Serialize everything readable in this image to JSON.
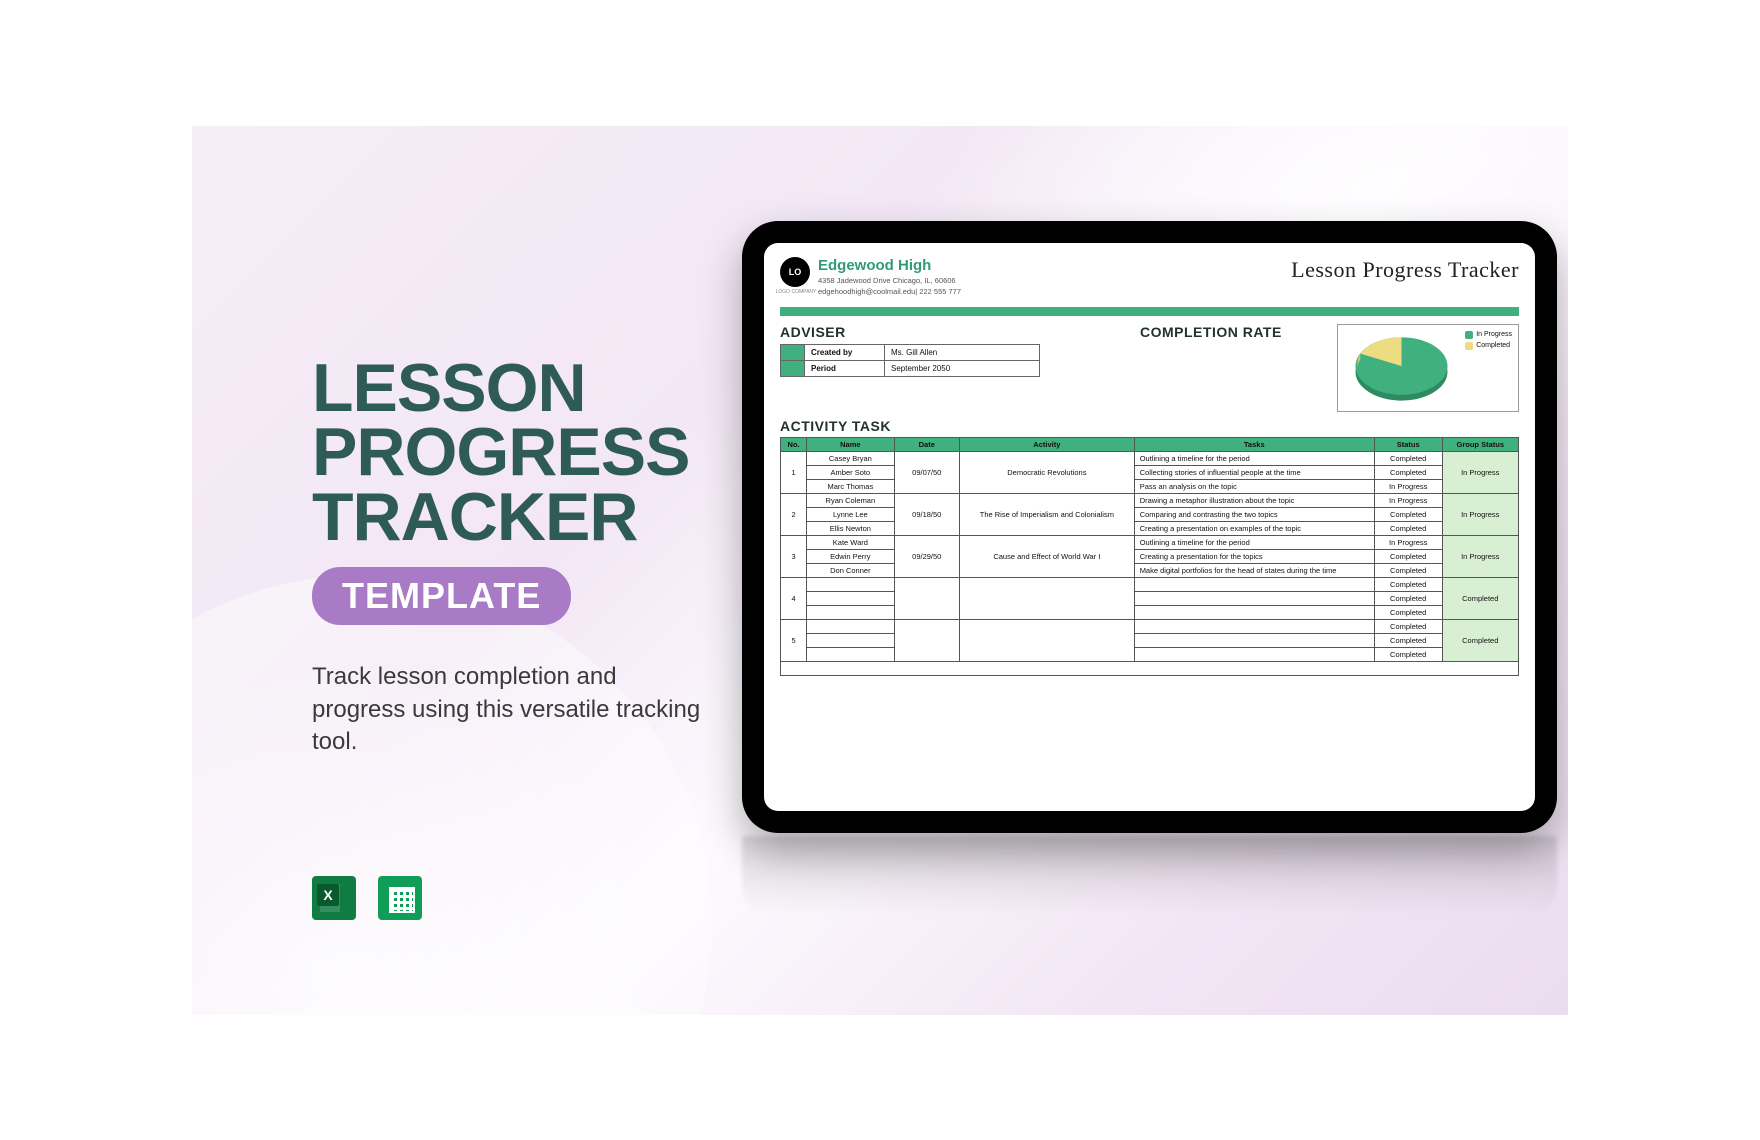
{
  "promo": {
    "title_l1": "LESSON",
    "title_l2": "PROGRESS",
    "title_l3": "TRACKER",
    "badge": "TEMPLATE",
    "desc": "Track lesson completion and progress using this versatile tracking tool."
  },
  "tracker": {
    "logo_text": "LO GO",
    "school": "Edgewood High",
    "address": "4358 Jadewood Drive Chicago, IL, 60606",
    "contact": "edgehoodhigh@coolmail.edu| 222 555 777",
    "page_title": "Lesson Progress Tracker",
    "adviser_h": "ADVISER",
    "adviser": {
      "created_by_label": "Created by",
      "created_by": "Ms. Gill Allen",
      "period_label": "Period",
      "period": "September 2050"
    },
    "completion_h": "COMPLETION RATE",
    "legend": {
      "inprog": "In Progress",
      "completed": "Completed"
    },
    "activity_h": "ACTIVITY TASK",
    "headers": {
      "no": "No.",
      "name": "Name",
      "date": "Date",
      "activity": "Activity",
      "tasks": "Tasks",
      "status": "Status",
      "group": "Group Status"
    },
    "rows": [
      {
        "no": "1",
        "names": [
          "Casey Bryan",
          "Amber Soto",
          "Marc Thomas"
        ],
        "date": "09/07/50",
        "activity": "Democratic Revolutions",
        "tasks": [
          "Outlining a timeline for the period",
          "Collecting stories of influential people at the time",
          "Pass an analysis on the topic"
        ],
        "statuses": [
          "Completed",
          "Completed",
          "In Progress"
        ],
        "group": "In Progress"
      },
      {
        "no": "2",
        "names": [
          "Ryan Coleman",
          "Lynne Lee",
          "Ellis Newton"
        ],
        "date": "09/18/50",
        "activity": "The Rise of Imperialism and Colonialism",
        "tasks": [
          "Drawing a metaphor illustration about the topic",
          "Comparing and contrasting the two topics",
          "Creating a presentation on examples of the topic"
        ],
        "statuses": [
          "In Progress",
          "Completed",
          "Completed"
        ],
        "group": "In Progress"
      },
      {
        "no": "3",
        "names": [
          "Kate Ward",
          "Edwin Perry",
          "Don Conner"
        ],
        "date": "09/29/50",
        "activity": "Cause and Effect of World War I",
        "tasks": [
          "Outlining a timeline for the period",
          "Creating a presentation for the topics",
          "Make digital portfolios for the head of states during the time"
        ],
        "statuses": [
          "In Progress",
          "Completed",
          "Completed"
        ],
        "group": "In Progress"
      },
      {
        "no": "4",
        "names": [
          "",
          "",
          ""
        ],
        "date": "",
        "activity": "",
        "tasks": [
          "",
          "",
          ""
        ],
        "statuses": [
          "Completed",
          "Completed",
          "Completed"
        ],
        "group": "Completed"
      },
      {
        "no": "5",
        "names": [
          "",
          "",
          ""
        ],
        "date": "",
        "activity": "",
        "tasks": [
          "",
          "",
          ""
        ],
        "statuses": [
          "Completed",
          "Completed",
          "Completed"
        ],
        "group": "Completed"
      }
    ]
  },
  "chart_data": {
    "type": "pie",
    "series": [
      {
        "name": "In Progress",
        "value": 67,
        "color": "#3fb07e"
      },
      {
        "name": "Completed",
        "value": 33,
        "color": "#eedc82"
      }
    ],
    "title": "Completion Rate"
  }
}
